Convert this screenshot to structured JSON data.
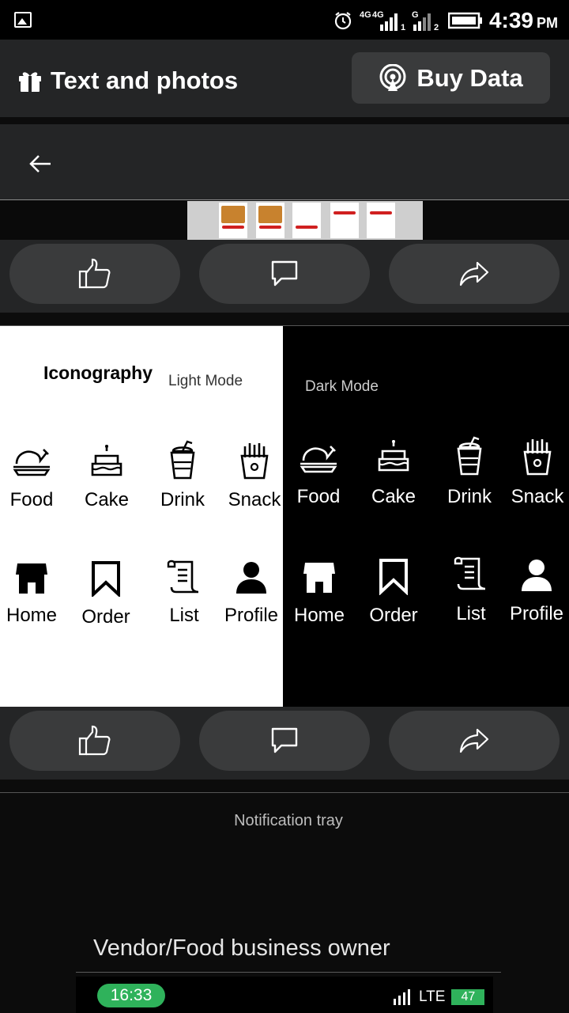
{
  "status_bar": {
    "time": "4:39",
    "ampm": "PM",
    "net1": "4G",
    "net2": "4G",
    "net3": "G",
    "sim1": "1",
    "sim2": "2"
  },
  "header": {
    "title": "Text and photos",
    "buy_label": "Buy Data"
  },
  "iconography": {
    "title": "Iconography",
    "light_label": "Light Mode",
    "dark_label": "Dark Mode",
    "light_items": [
      "Food",
      "Cake",
      "Drink",
      "Snack",
      "Home",
      "Order",
      "List",
      "Profile"
    ],
    "dark_items": [
      "Food",
      "Cake",
      "Drink",
      "Snack",
      "Home",
      "Order",
      "List",
      "Profile"
    ]
  },
  "post3": {
    "tray_label": "Notification tray",
    "vendor_label": "Vendor/Food business owner",
    "mini_time": "16:33",
    "mini_network": "LTE",
    "mini_battery": "47"
  },
  "colors": {
    "accent_green": "#2fb25b",
    "header_bg": "#242526",
    "pill_bg": "#3a3b3c"
  }
}
